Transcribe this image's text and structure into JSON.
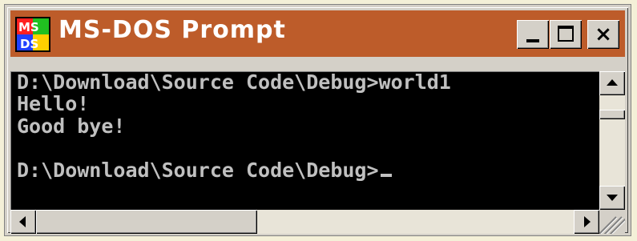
{
  "window": {
    "title": "MS-DOS Prompt",
    "app_icon": "ms-dos-icon",
    "title_bar_color": "#bd5c2a",
    "buttons": {
      "minimize": "minimize-icon",
      "maximize": "maximize-icon",
      "close": "close-icon",
      "close_glyph": "×"
    }
  },
  "console": {
    "background": "#000000",
    "text_color": "#c0c0c0",
    "lines": [
      "D:\\Download\\Source Code\\Debug>world1",
      "Hello!",
      "Good bye!",
      "D:\\Download\\Source Code\\Debug>"
    ]
  },
  "scrollbars": {
    "vertical": {
      "position_fraction": 0.2
    },
    "horizontal": {
      "position_fraction": 0.0,
      "visible_fraction": 0.4
    }
  }
}
